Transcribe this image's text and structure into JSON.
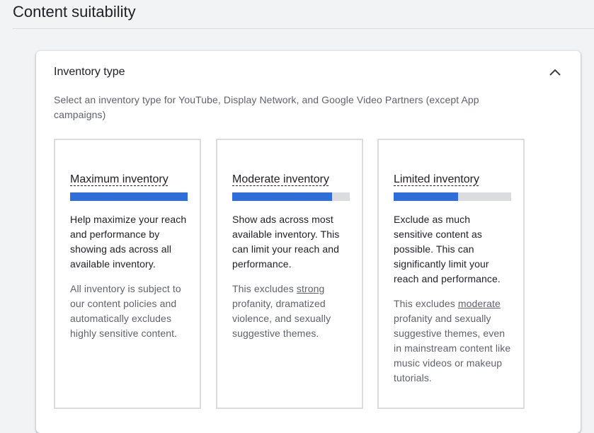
{
  "page": {
    "title": "Content suitability"
  },
  "card": {
    "title": "Inventory type",
    "description": "Select an inventory type for YouTube, Display Network, and Google Video Partners (except App campaigns)",
    "collapse_icon": "chevron-up-icon"
  },
  "options": [
    {
      "title": "Maximum inventory",
      "level": 1.0,
      "body": "Help maximize your reach and performance by showing ads across all available inventory.",
      "note_before": "All inventory is subject to our content policies and automatically excludes highly sensitive content.",
      "note_link": "",
      "note_after": ""
    },
    {
      "title": "Moderate inventory",
      "level": 0.85,
      "body": "Show ads across most available inventory. This can limit your reach and performance.",
      "note_before": "This excludes ",
      "note_link": "strong",
      "note_after": " profanity, dramatized violence, and sexually suggestive themes."
    },
    {
      "title": "Limited inventory",
      "level": 0.55,
      "body": "Exclude as much sensitive content as possible. This can significantly limit your reach and performance.",
      "note_before": "This excludes ",
      "note_link": "moderate",
      "note_after": " profanity and sexually suggestive themes, even in mainstream content like music videos or makeup tutorials."
    }
  ],
  "colors": {
    "meter_fill": "#2f6ddb",
    "meter_track": "#dadce0",
    "border": "#dadce0"
  }
}
